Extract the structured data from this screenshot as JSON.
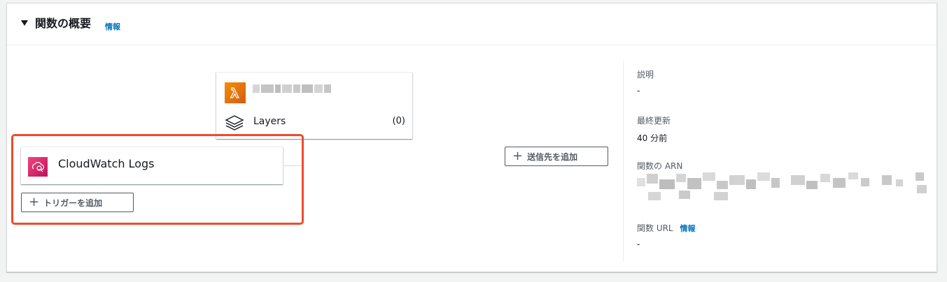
{
  "header": {
    "title": "関数の概要",
    "info_link": "情報"
  },
  "function_card": {
    "layers_label": "Layers",
    "layers_count": "(0)"
  },
  "trigger_card": {
    "label": "CloudWatch Logs"
  },
  "buttons": {
    "add_trigger": "トリガーを追加",
    "add_destination": "送信先を追加"
  },
  "details": {
    "description_label": "説明",
    "description_value": "-",
    "last_modified_label": "最終更新",
    "last_modified_value": "40 分前",
    "arn_label": "関数の ARN",
    "url_label": "関数 URL",
    "url_info_link": "情報",
    "url_value": "-"
  },
  "colors": {
    "lambda_icon": "#e7730f",
    "cloudwatch_icon": "#e7157b",
    "highlight_border": "#ee4b2b",
    "link": "#0073bb"
  }
}
